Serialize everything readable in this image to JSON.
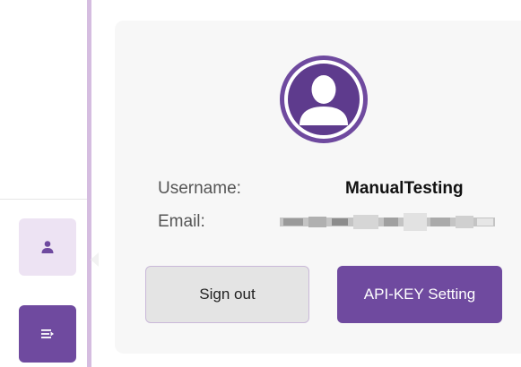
{
  "sidebar": {
    "profile_icon": "user-icon",
    "menu_icon": "menu-toggle-icon"
  },
  "profile": {
    "avatar_icon": "user-avatar-icon",
    "username_label": "Username:",
    "username_value": "ManualTesting",
    "email_label": "Email:",
    "email_value": ""
  },
  "actions": {
    "sign_out_label": "Sign out",
    "api_key_label": "API-KEY Setting"
  },
  "colors": {
    "accent": "#6f4a9f",
    "accent_light": "#ede3f3",
    "sidebar_rail": "#d5bde0",
    "panel_bg": "#f7f7f7"
  }
}
